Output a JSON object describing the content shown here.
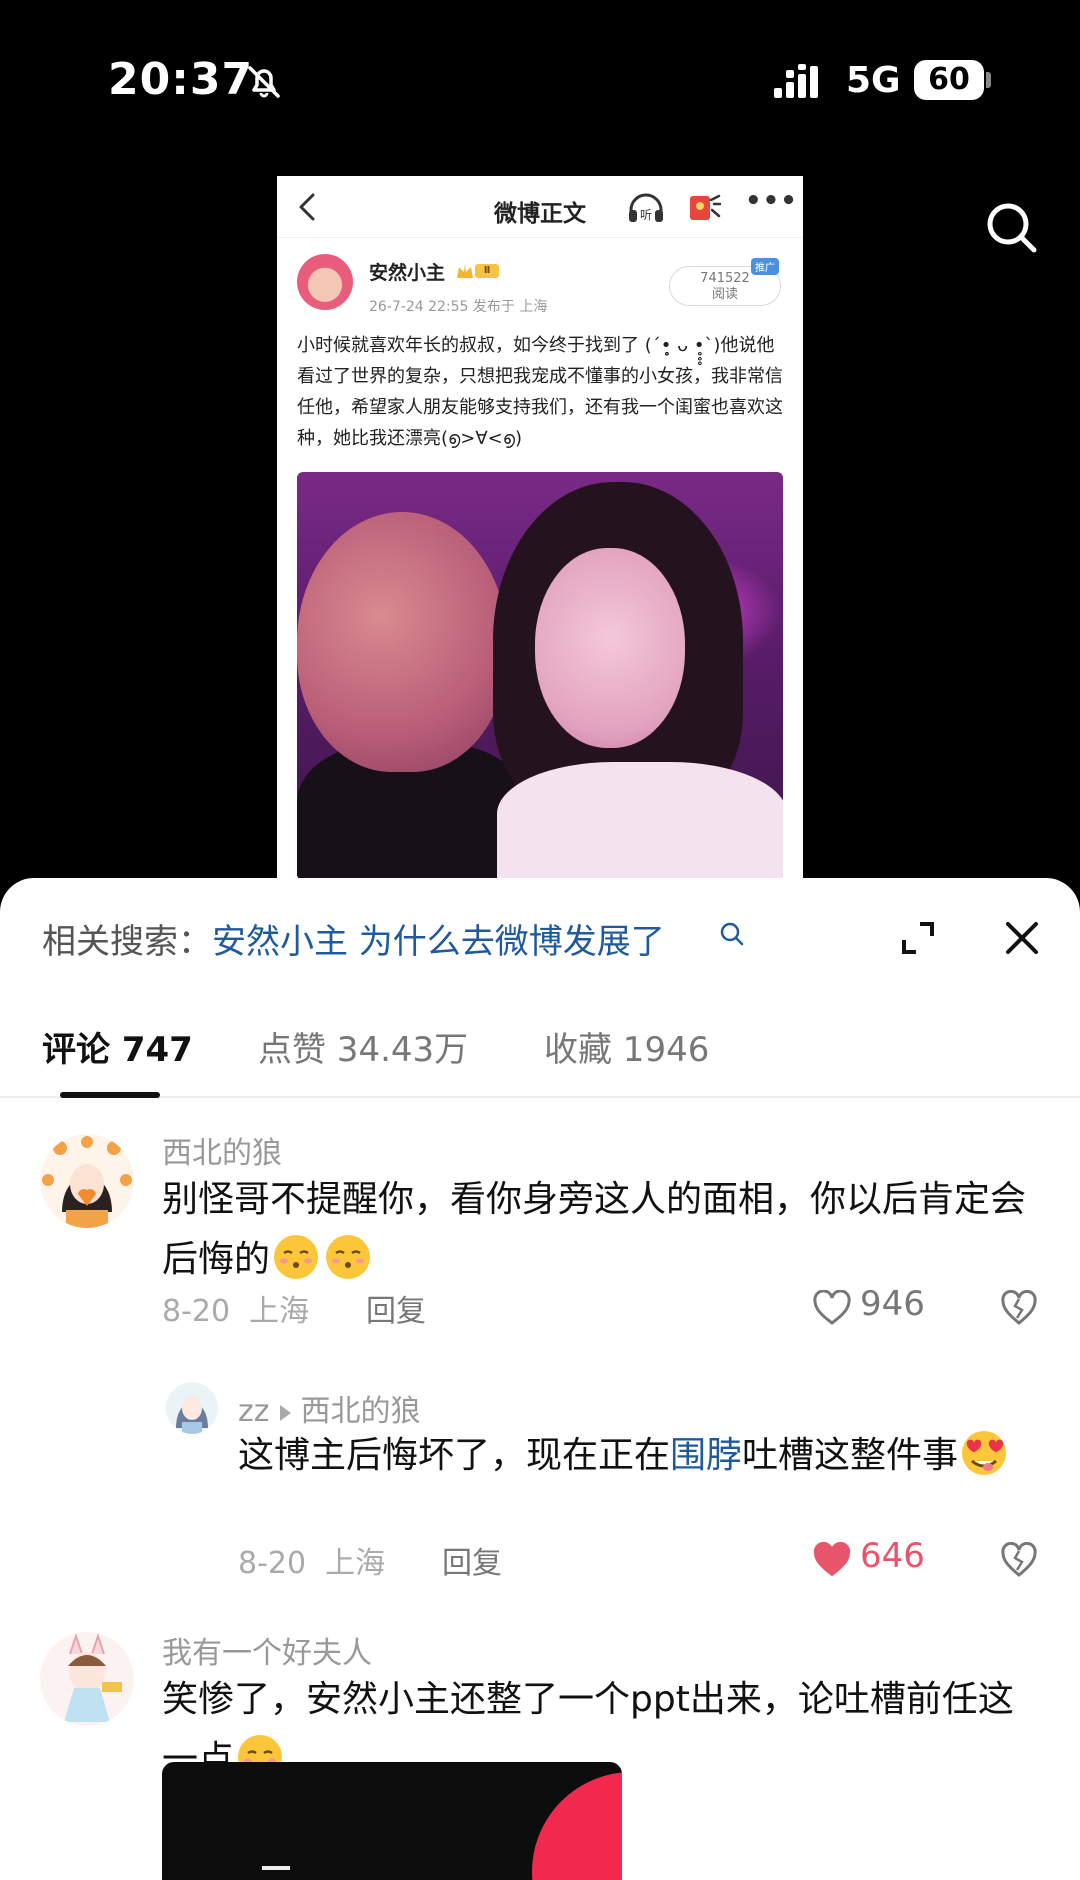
{
  "status_bar": {
    "time": "20:37",
    "network": "5G",
    "battery": "60"
  },
  "weibo_post": {
    "header_title": "微博正文",
    "listen_label": "听",
    "author": "安然小主",
    "level": "Ⅱ",
    "meta": "26-7-24 22:55  发布于 上海",
    "reads": "741522",
    "reads_label": "阅读",
    "promo_badge": "推广",
    "text": "小时候就喜欢年长的叔叔，如今终于找到了 (´•̥̥̥ ᴗ •̥̥̥`)他说他看过了世界的复杂，只想把我宠成不懂事的小女孩，我非常信任他，希望家人朋友能够支持我们，还有我一个闺蜜也喜欢这种，她比我还漂亮(൭>∀<൭)"
  },
  "sheet": {
    "related_prefix": "相关搜索：",
    "related_query": "安然小主 为什么去微博发展了",
    "tabs": [
      {
        "label": "评论 747"
      },
      {
        "label": "点赞 34.43万"
      },
      {
        "label": "收藏 1946"
      }
    ]
  },
  "comments": [
    {
      "user": "西北的狼",
      "text": "别怪哥不提醒你，看你身旁这人的面相，你以后肯定会后悔的",
      "date": "8-20",
      "location": "上海",
      "reply_label": "回复",
      "likes": "946"
    },
    {
      "user": "zz",
      "reply_to": "西北的狼",
      "text_before": "这博主后悔坏了，现在正在",
      "text_link": "围脖",
      "text_after": "吐槽这整件事",
      "date": "8-20",
      "location": "上海",
      "reply_label": "回复",
      "likes": "646"
    },
    {
      "user": "我有一个好夫人",
      "text": "笑惨了，安然小主还整了一个ppt出来，论吐槽前任这一点"
    }
  ],
  "colors": {
    "link": "#1f5a9e",
    "liked": "#e8546a",
    "photo_tint": "#7a2a86"
  }
}
